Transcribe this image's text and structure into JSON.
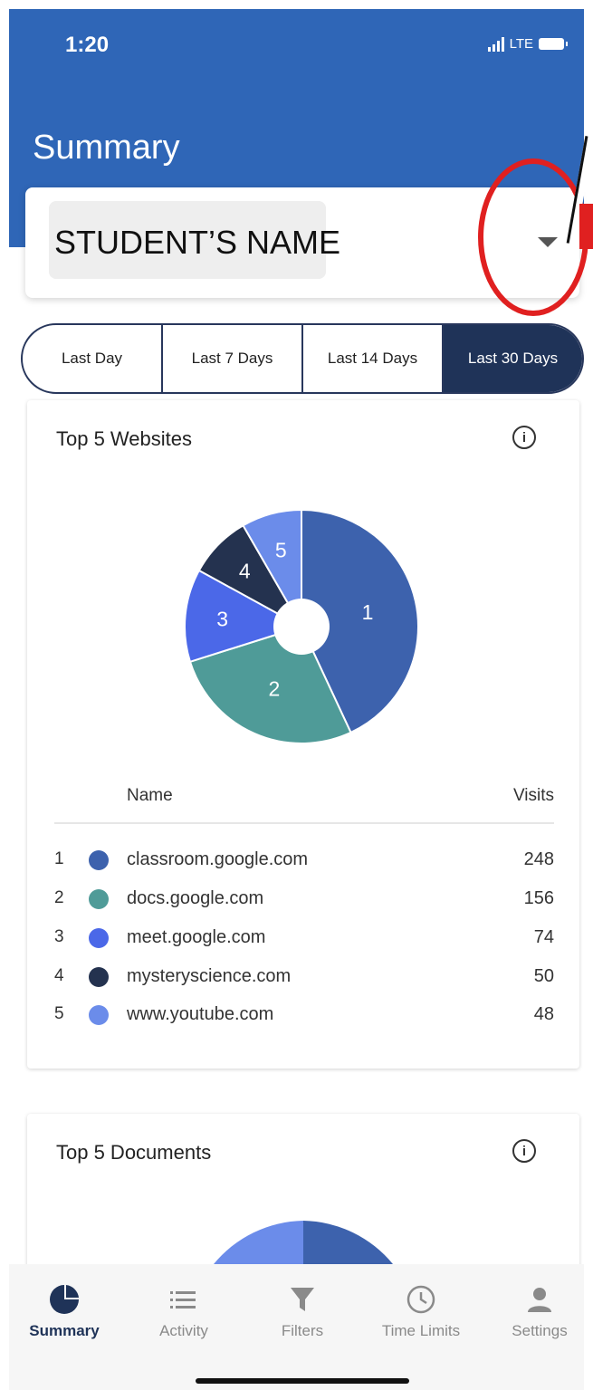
{
  "status": {
    "time": "1:20",
    "network": "LTE"
  },
  "header": {
    "title": "Summary"
  },
  "student": {
    "name": "STUDENT’S NAME"
  },
  "ranges": [
    {
      "label": "Last Day",
      "active": false
    },
    {
      "label": "Last 7 Days",
      "active": false
    },
    {
      "label": "Last 14 Days",
      "active": false
    },
    {
      "label": "Last 30 Days",
      "active": true
    }
  ],
  "websites": {
    "title": "Top 5 Websites",
    "columns": {
      "name": "Name",
      "visits": "Visits"
    },
    "rows": [
      {
        "rank": "1",
        "name": "classroom.google.com",
        "visits": "248",
        "color": "#3d62ad"
      },
      {
        "rank": "2",
        "name": "docs.google.com",
        "visits": "156",
        "color": "#4f9b98"
      },
      {
        "rank": "3",
        "name": "meet.google.com",
        "visits": "74",
        "color": "#4b68e8"
      },
      {
        "rank": "4",
        "name": "mysteryscience.com",
        "visits": "50",
        "color": "#24324f"
      },
      {
        "rank": "5",
        "name": "www.youtube.com",
        "visits": "48",
        "color": "#6b8cea"
      }
    ]
  },
  "documents": {
    "title": "Top 5 Documents"
  },
  "nav": [
    {
      "label": "Summary",
      "icon": "summary-pie-icon",
      "active": true
    },
    {
      "label": "Activity",
      "icon": "list-icon",
      "active": false
    },
    {
      "label": "Filters",
      "icon": "filter-icon",
      "active": false
    },
    {
      "label": "Time Limits",
      "icon": "clock-icon",
      "active": false
    },
    {
      "label": "Settings",
      "icon": "person-icon",
      "active": false
    }
  ],
  "chart_data": {
    "type": "pie",
    "categories": [
      "1",
      "2",
      "3",
      "4",
      "5"
    ],
    "values": [
      248,
      156,
      74,
      50,
      48
    ],
    "colors": [
      "#3d62ad",
      "#4f9b98",
      "#4b68e8",
      "#24324f",
      "#6b8cea"
    ]
  }
}
